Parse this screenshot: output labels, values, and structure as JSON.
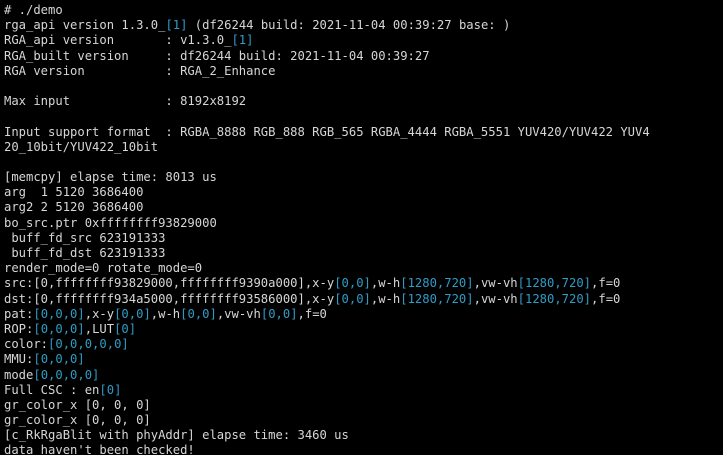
{
  "theme": {
    "background": "#000000",
    "text": "#d6d6d6",
    "accent": "#2f9cc6"
  },
  "terminal": {
    "lines": [
      [
        {
          "t": "# ./demo"
        }
      ],
      [
        {
          "t": "rga_api version 1.3.0_"
        },
        {
          "t": "[1]",
          "c": "accent"
        },
        {
          "t": " (df26244 build: 2021-11-04 00:39:27 base: )"
        }
      ],
      [
        {
          "t": "RGA_api version       : v1.3.0_"
        },
        {
          "t": "[1]",
          "c": "accent"
        }
      ],
      [
        {
          "t": "RGA_built version     : df26244 build: 2021-11-04 00:39:27"
        }
      ],
      [
        {
          "t": "RGA version           : RGA_2_Enhance"
        }
      ],
      [],
      [
        {
          "t": "Max input             : 8192x8192"
        }
      ],
      [],
      [
        {
          "t": "Input support format  : RGBA_8888 RGB_888 RGB_565 RGBA_4444 RGBA_5551 YUV420/YUV422 YUV4"
        }
      ],
      [
        {
          "t": "20_10bit/YUV422_10bit"
        }
      ],
      [],
      [
        {
          "t": "[memcpy] elapse time: 8013 us"
        }
      ],
      [
        {
          "t": "arg  1 5120 3686400"
        }
      ],
      [
        {
          "t": "arg2 2 5120 3686400"
        }
      ],
      [
        {
          "t": "bo_src.ptr 0xffffffff93829000"
        }
      ],
      [
        {
          "t": " buff_fd_src 623191333"
        }
      ],
      [
        {
          "t": " buff_fd_dst 623191333"
        }
      ],
      [
        {
          "t": "render_mode=0 rotate_mode=0"
        }
      ],
      [
        {
          "t": "src:[0,ffffffff93829000,ffffffff9390a000],x-y"
        },
        {
          "t": "[0,0]",
          "c": "accent"
        },
        {
          "t": ",w-h"
        },
        {
          "t": "[1280,720]",
          "c": "accent"
        },
        {
          "t": ",vw-vh"
        },
        {
          "t": "[1280,720]",
          "c": "accent"
        },
        {
          "t": ",f=0"
        }
      ],
      [
        {
          "t": "dst:[0,ffffffff934a5000,ffffffff93586000],x-y"
        },
        {
          "t": "[0,0]",
          "c": "accent"
        },
        {
          "t": ",w-h"
        },
        {
          "t": "[1280,720]",
          "c": "accent"
        },
        {
          "t": ",vw-vh"
        },
        {
          "t": "[1280,720]",
          "c": "accent"
        },
        {
          "t": ",f=0"
        }
      ],
      [
        {
          "t": "pat:"
        },
        {
          "t": "[0,0,0]",
          "c": "accent"
        },
        {
          "t": ",x-y"
        },
        {
          "t": "[0,0]",
          "c": "accent"
        },
        {
          "t": ",w-h"
        },
        {
          "t": "[0,0]",
          "c": "accent"
        },
        {
          "t": ",vw-vh"
        },
        {
          "t": "[0,0]",
          "c": "accent"
        },
        {
          "t": ",f=0"
        }
      ],
      [
        {
          "t": "ROP:"
        },
        {
          "t": "[0,0,0]",
          "c": "accent"
        },
        {
          "t": ",LUT"
        },
        {
          "t": "[0]",
          "c": "accent"
        }
      ],
      [
        {
          "t": "color:"
        },
        {
          "t": "[0,0,0,0,0]",
          "c": "accent"
        }
      ],
      [
        {
          "t": "MMU:"
        },
        {
          "t": "[0,0,0]",
          "c": "accent"
        }
      ],
      [
        {
          "t": "mode"
        },
        {
          "t": "[0,0,0,0]",
          "c": "accent"
        }
      ],
      [
        {
          "t": "Full CSC : en"
        },
        {
          "t": "[0]",
          "c": "accent"
        }
      ],
      [
        {
          "t": "gr_color_x [0, 0, 0]"
        }
      ],
      [
        {
          "t": "gr_color_x [0, 0, 0]"
        }
      ],
      [
        {
          "t": "[c_RkRgaBlit with phyAddr] elapse time: 3460 us"
        }
      ],
      [
        {
          "t": "data haven't been checked!"
        }
      ]
    ]
  }
}
